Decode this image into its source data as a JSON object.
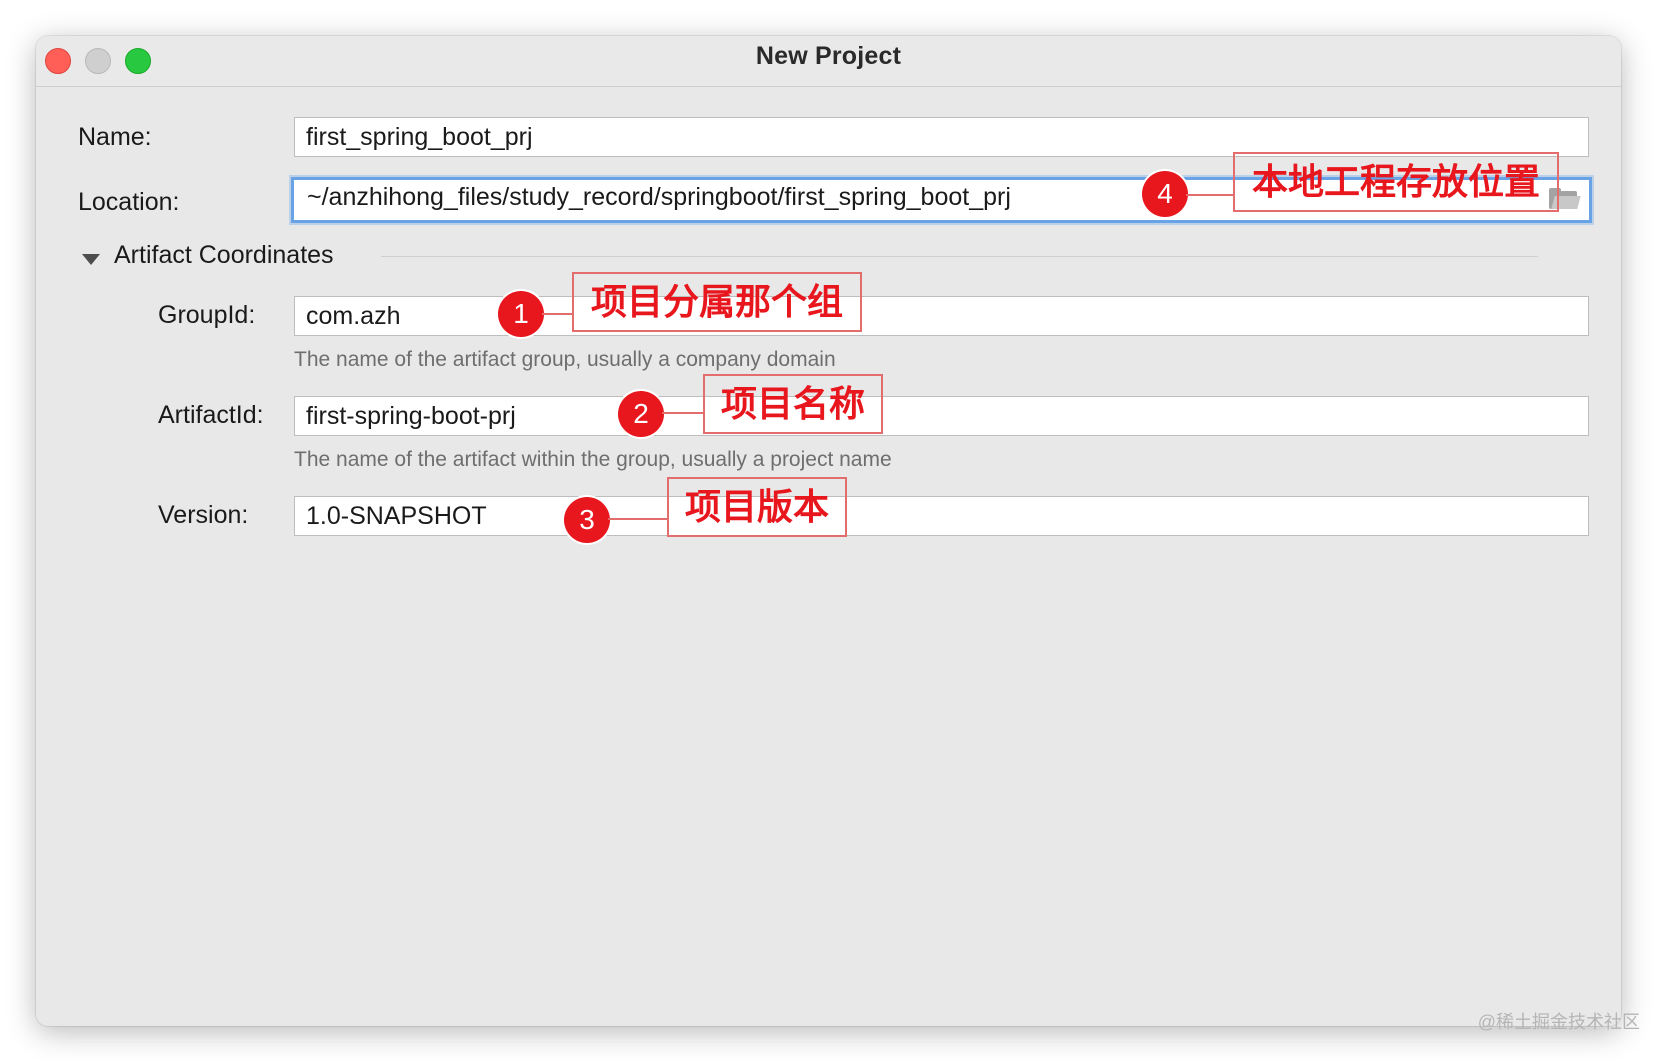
{
  "window": {
    "title": "New Project"
  },
  "form": {
    "name_label": "Name:",
    "name_value": "first_spring_boot_prj",
    "location_label": "Location:",
    "location_value": "~/anzhihong_files/study_record/springboot/first_spring_boot_prj",
    "section_title": "Artifact Coordinates",
    "groupid_label": "GroupId:",
    "groupid_value": "com.azh",
    "groupid_hint": "The name of the artifact group, usually a company domain",
    "artifactid_label": "ArtifactId:",
    "artifactid_value": "first-spring-boot-prj",
    "artifactid_hint": "The name of the artifact within the group, usually a project name",
    "version_label": "Version:",
    "version_value": "1.0-SNAPSHOT"
  },
  "annotations": [
    {
      "number": "1",
      "text": "项目分属那个组"
    },
    {
      "number": "2",
      "text": "项目名称"
    },
    {
      "number": "3",
      "text": "项目版本"
    },
    {
      "number": "4",
      "text": "本地工程存放位置"
    }
  ],
  "icons": {
    "folder": "folder-icon",
    "disclosure": "disclosure-triangle-icon"
  },
  "colors": {
    "annotation_red": "#e8161d",
    "focus_blue": "#6aa2e6",
    "window_bg": "#e8e8e8"
  },
  "watermark": "@稀土掘金技术社区"
}
